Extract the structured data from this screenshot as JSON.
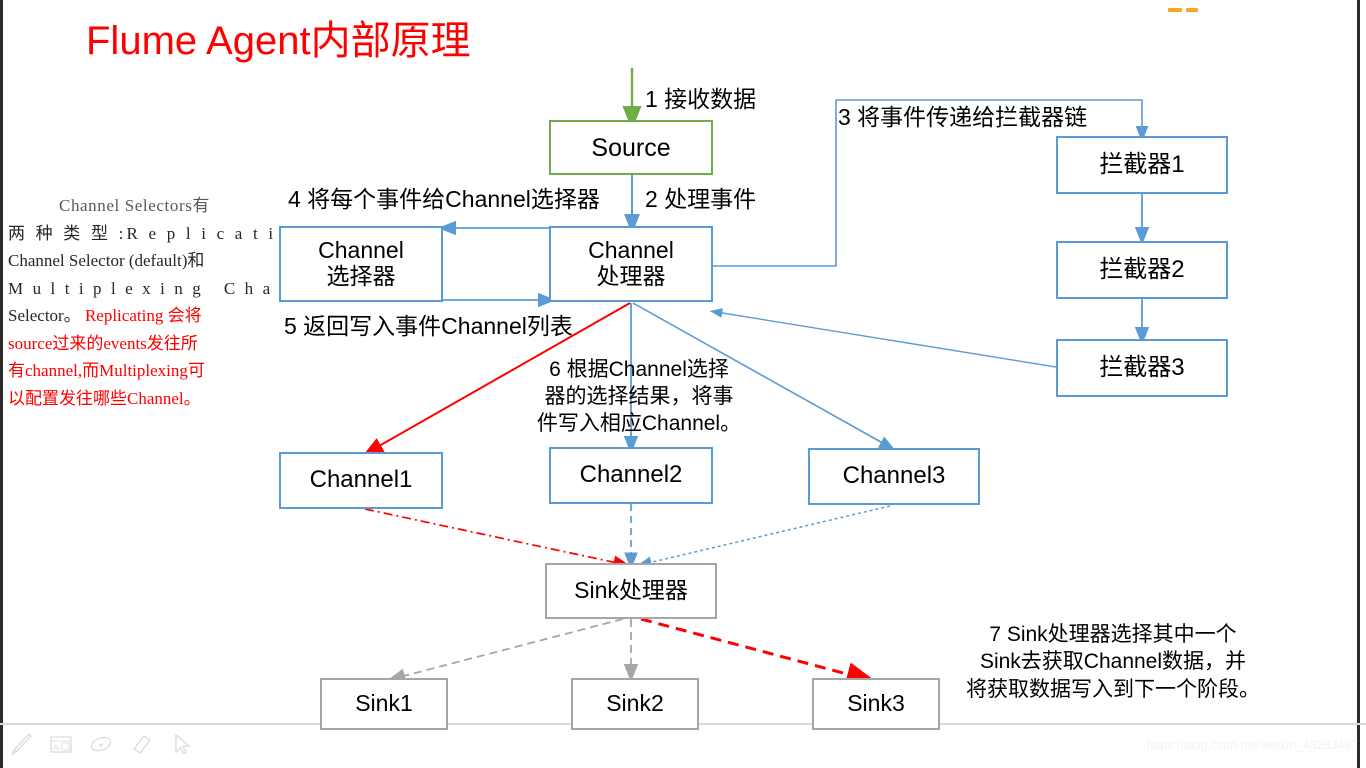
{
  "title": "Flume Agent内部原理",
  "sidebar_note": {
    "lines": [
      {
        "text": "Channel Selectors有",
        "color": "#595959",
        "style": "first"
      },
      {
        "text": "两 种 类 型 :R e p l i c a t i n g",
        "color": "#262626",
        "style": "normal"
      },
      {
        "text": "Channel Selector (default)和",
        "color": "#262626",
        "style": "normal"
      },
      {
        "text": "M u l t i p l e x i n g   C h a n n e l",
        "color": "#262626",
        "style": "normal"
      },
      {
        "text": "Selector。",
        "color": "#262626",
        "style": "mixed",
        "red_tail": " Replicating 会将"
      },
      {
        "text": "source过来的events发往所",
        "color": "#ff0000",
        "style": "normal"
      },
      {
        "text": "有channel,而Multiplexing可",
        "color": "#ff0000",
        "style": "normal"
      },
      {
        "text": "以配置发往哪些Channel。",
        "color": "#ff0000",
        "style": "normal"
      }
    ]
  },
  "nodes": {
    "source": {
      "label": "Source",
      "border": "#70ad47"
    },
    "channel_processor": {
      "label": "Channel\n处理器",
      "border": "#5b9bd5"
    },
    "channel_selector": {
      "label": "Channel\n选择器",
      "border": "#5b9bd5"
    },
    "interceptor1": {
      "label": "拦截器1",
      "border": "#5b9bd5"
    },
    "interceptor2": {
      "label": "拦截器2",
      "border": "#5b9bd5"
    },
    "interceptor3": {
      "label": "拦截器3",
      "border": "#5b9bd5"
    },
    "channel1": {
      "label": "Channel1",
      "border": "#5b9bd5"
    },
    "channel2": {
      "label": "Channel2",
      "border": "#5b9bd5"
    },
    "channel3": {
      "label": "Channel3",
      "border": "#5b9bd5"
    },
    "sink_processor": {
      "label": "Sink处理器",
      "border": "#a6a6a6"
    },
    "sink1": {
      "label": "Sink1",
      "border": "#a6a6a6"
    },
    "sink2": {
      "label": "Sink2",
      "border": "#a6a6a6"
    },
    "sink3": {
      "label": "Sink3",
      "border": "#a6a6a6"
    }
  },
  "step_labels": {
    "step1": "1 接收数据",
    "step2": "2 处理事件",
    "step3": "3 将事件传递给拦截器链",
    "step4": "4 将每个事件给Channel选择器",
    "step5": "5 返回写入事件Channel列表",
    "step6": "6 根据Channel选择\n器的选择结果，将事\n件写入相应Channel。",
    "step7": "7 Sink处理器选择其中一个\nSink去获取Channel数据，并\n将获取数据写入到下一个阶段。"
  },
  "colors": {
    "title_red": "#ff0000",
    "blue": "#5b9bd5",
    "green": "#70ad47",
    "gray": "#a6a6a6",
    "red_arrow": "#ff0000"
  },
  "toolbar": {
    "icons": [
      "pen-icon",
      "whiteboard-icon",
      "highlighter-icon",
      "eraser-icon",
      "cursor-icon"
    ]
  },
  "watermark": "https://blog.csdn.net/weixin_43283487"
}
